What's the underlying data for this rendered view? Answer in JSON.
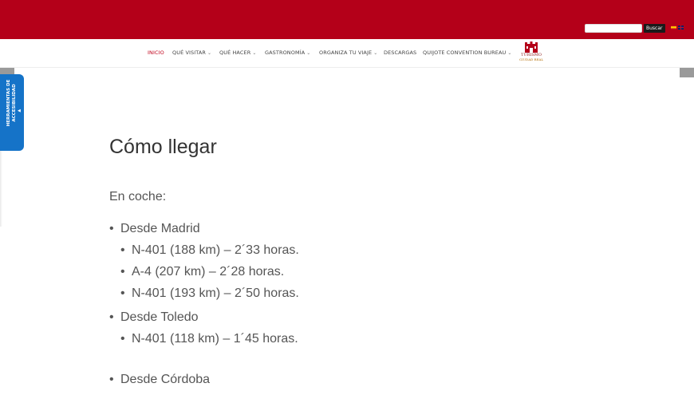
{
  "header": {
    "search_button": "Buscar"
  },
  "nav": {
    "items": [
      {
        "label": "INICIO",
        "dropdown": false,
        "active": true
      },
      {
        "label": "QUÉ VISITAR",
        "dropdown": true,
        "active": false
      },
      {
        "label": "QUÉ HACER",
        "dropdown": true,
        "active": false
      },
      {
        "label": "GASTRONOMÍA",
        "dropdown": true,
        "active": false
      },
      {
        "label": "ORGANIZA TU VIAJE",
        "dropdown": true,
        "active": false
      },
      {
        "label": "DESCARGAS",
        "dropdown": false,
        "active": false
      },
      {
        "label": "QUIJOTE CONVENTION BUREAU",
        "dropdown": true,
        "active": false
      }
    ],
    "logo": {
      "line1": "TURISMO",
      "line2": "CIUDAD REAL"
    }
  },
  "accessibility": {
    "label_line1": "HERRAMIENTAS DE",
    "label_line2": "ACCESIBILIDAD"
  },
  "content": {
    "title": "Cómo llegar",
    "section": "En coche:",
    "routes": [
      {
        "origin": "Desde Madrid",
        "options": [
          "N-401 (188 km) – 2´33 horas.",
          "A-4 (207 km) – 2´28 horas.",
          "N-401 (193 km) – 2´50 horas."
        ]
      },
      {
        "origin": "Desde Toledo",
        "options": [
          "N-401 (118 km) – 1´45 horas."
        ]
      },
      {
        "origin": "Desde Córdoba",
        "options": []
      }
    ]
  },
  "colors": {
    "brand_red": "#b40019",
    "accessibility_blue": "#1573c8"
  }
}
